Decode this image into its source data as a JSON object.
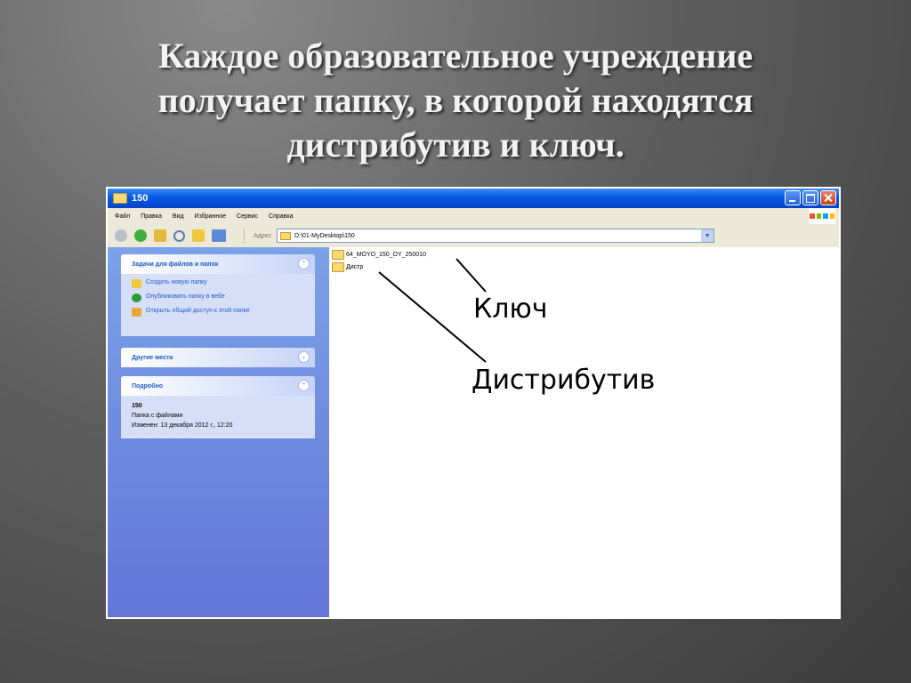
{
  "slide": {
    "title": "Каждое образовательное учреждение\nполучает папку, в которой находятся\nдистрибутив и ключ."
  },
  "window": {
    "title": "150",
    "menu": [
      "Файл",
      "Правка",
      "Вид",
      "Избранное",
      "Сервис",
      "Справка"
    ],
    "address": {
      "label": "Адрес",
      "value": "D:\\01-MyDesktop\\150"
    },
    "tasks_panel": {
      "title": "Задачи для файлов и папок",
      "items": [
        {
          "label": "Создать новую папку",
          "icon": "new-folder-icon"
        },
        {
          "label": "Опубликовать папку в вебе",
          "icon": "web-publish-icon"
        },
        {
          "label": "Открыть общий доступ к этой папке",
          "icon": "share-folder-icon"
        }
      ]
    },
    "places_panel": {
      "title": "Другие места"
    },
    "details_panel": {
      "title": "Подробно",
      "name": "150",
      "type": "Папка с файлами",
      "modified": "Изменен: 13 декабря 2012 г., 12:20"
    },
    "files": [
      {
        "name": "64_MOYO_150_OY_250010"
      },
      {
        "name": "Дистр"
      }
    ]
  },
  "annotations": {
    "key_label": "Ключ",
    "distrib_label": "Дистрибутив"
  }
}
